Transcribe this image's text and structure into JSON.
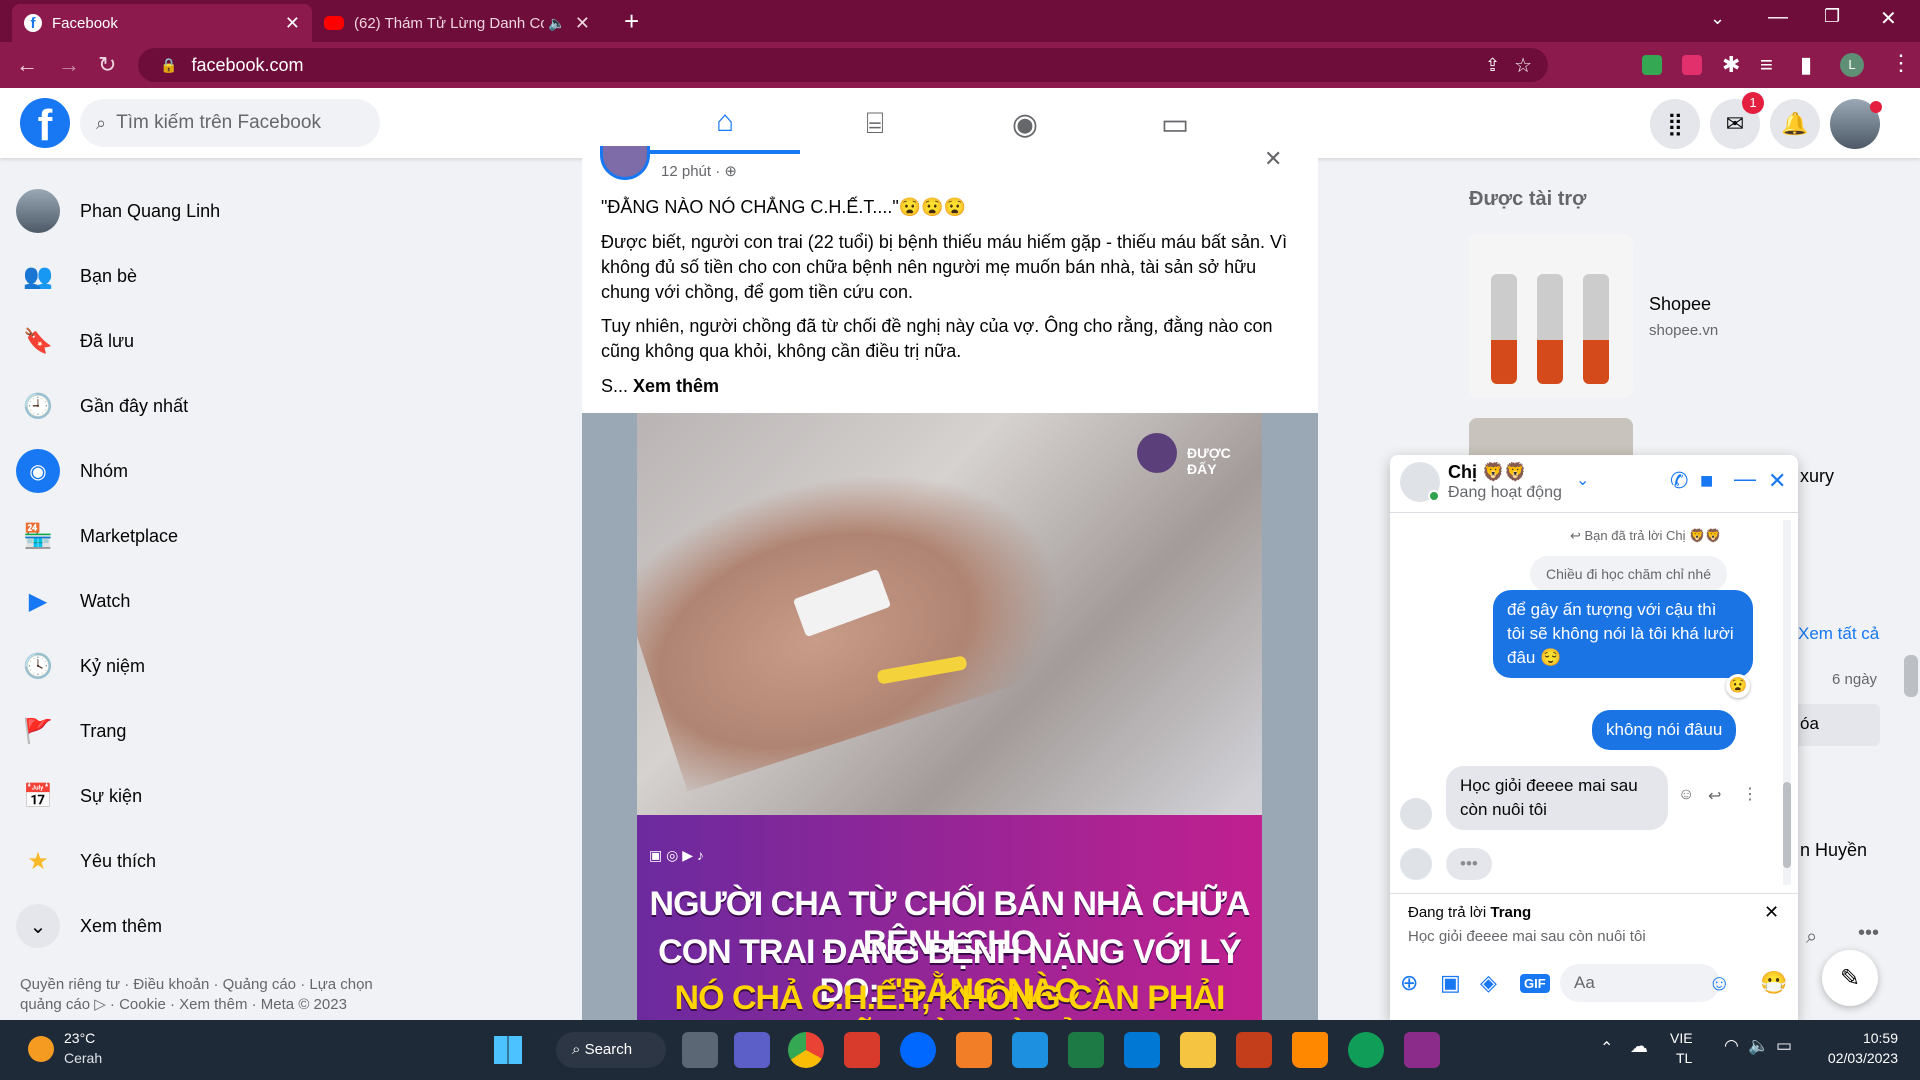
{
  "browser": {
    "tabs": [
      {
        "title": "Facebook",
        "icon": "facebook-icon"
      },
      {
        "title": "(62) Thám Tử Lừng Danh Co",
        "icon": "youtube-icon"
      }
    ],
    "url": "facebook.com",
    "new_tab": "+"
  },
  "header": {
    "search_placeholder": "Tìm kiếm trên Facebook",
    "messenger_badge": "1"
  },
  "sidebar": {
    "items": [
      {
        "label": "Phan Quang Linh"
      },
      {
        "label": "Bạn bè"
      },
      {
        "label": "Đã lưu"
      },
      {
        "label": "Gần đây nhất"
      },
      {
        "label": "Nhóm"
      },
      {
        "label": "Marketplace"
      },
      {
        "label": "Watch"
      },
      {
        "label": "Kỷ niệm"
      },
      {
        "label": "Trang"
      },
      {
        "label": "Sự kiện"
      },
      {
        "label": "Yêu thích"
      },
      {
        "label": "Xem thêm"
      }
    ],
    "footer": "Quyền riêng tư · Điều khoản · Quảng cáo · Lựa chọn quảng cáo ▷ · Cookie · Xem thêm · Meta © 2023"
  },
  "post": {
    "time": "12 phút · ",
    "headline": "\"ĐẰNG NÀO NÓ CHẲNG C.H.Ế.T....\"😧😧😧",
    "para1": "Được biết, người con trai (22 tuổi) bị bệnh thiếu máu hiếm gặp - thiếu máu bất sản. Vì không đủ số tiền cho con chữa bệnh nên người mẹ muốn bán nhà, tài sản sở hữu chung với chồng, để gom tiền cứu con.",
    "para2": "Tuy nhiên, người chồng đã từ chối đề nghị này của vợ. Ông cho rằng, đằng nào con cũng không qua khỏi, không cần điều trị nữa.",
    "truncated": "S... ",
    "see_more": "Xem thêm",
    "watermark": "ĐƯỢC ĐẤY",
    "banner_line1": "NGƯỜI CHA TỪ CHỐI BÁN NHÀ CHỮA BỆNH CHO",
    "banner_line2_a": "CON TRAI ĐANG BỆNH NẶNG VỚI LÝ DO: ",
    "banner_line2_b": "\"ĐẰNG NÀO",
    "banner_line3": "NÓ CHẢ C.H.Ế.T, KHÔNG CẦN PHẢI CHỮA LÀM GÌ CẢ\""
  },
  "right": {
    "sponsored_title": "Được tài trợ",
    "ad1_name": "Shopee",
    "ad1_url": "shopee.vn",
    "partial_luxury": "xury",
    "see_all": "Xem tất cả",
    "days": "6 ngày",
    "partial_oa": "óa",
    "partial_name": "n Huyền"
  },
  "chat": {
    "name": "Chị 🦁🦁",
    "status": "Đang hoạt động",
    "replied_note": "Bạn đã trả lời Chị 🦁🦁",
    "quoted": "Chiều đi học chăm chỉ nhé",
    "msg1": "để gây ấn tượng với cậu thì tôi sẽ không nói là tôi khá lười đâu 😌",
    "msg1_reaction": "😧",
    "msg2": "không nói đâuu",
    "msg3": "Học giỏi đeeee mai sau còn nuôi tôi",
    "typing": "•••",
    "replying_to_label": "Đang trả lời ",
    "replying_to_name": "Trang",
    "replying_to_text": "Học giỏi đeeee mai sau còn nuôi tôi",
    "input_placeholder": "Aa"
  },
  "taskbar": {
    "weather_temp": "23°C",
    "weather_desc": "Cerah",
    "search": "Search",
    "lang1": "VIE",
    "lang2": "TL",
    "time": "10:59",
    "date": "02/03/2023"
  },
  "colors": {
    "chrome_dark": "#6e0d3a",
    "chrome_main": "#8c1a4c",
    "fb_blue": "#1877f2",
    "messenger_blue": "#1b74e4"
  }
}
